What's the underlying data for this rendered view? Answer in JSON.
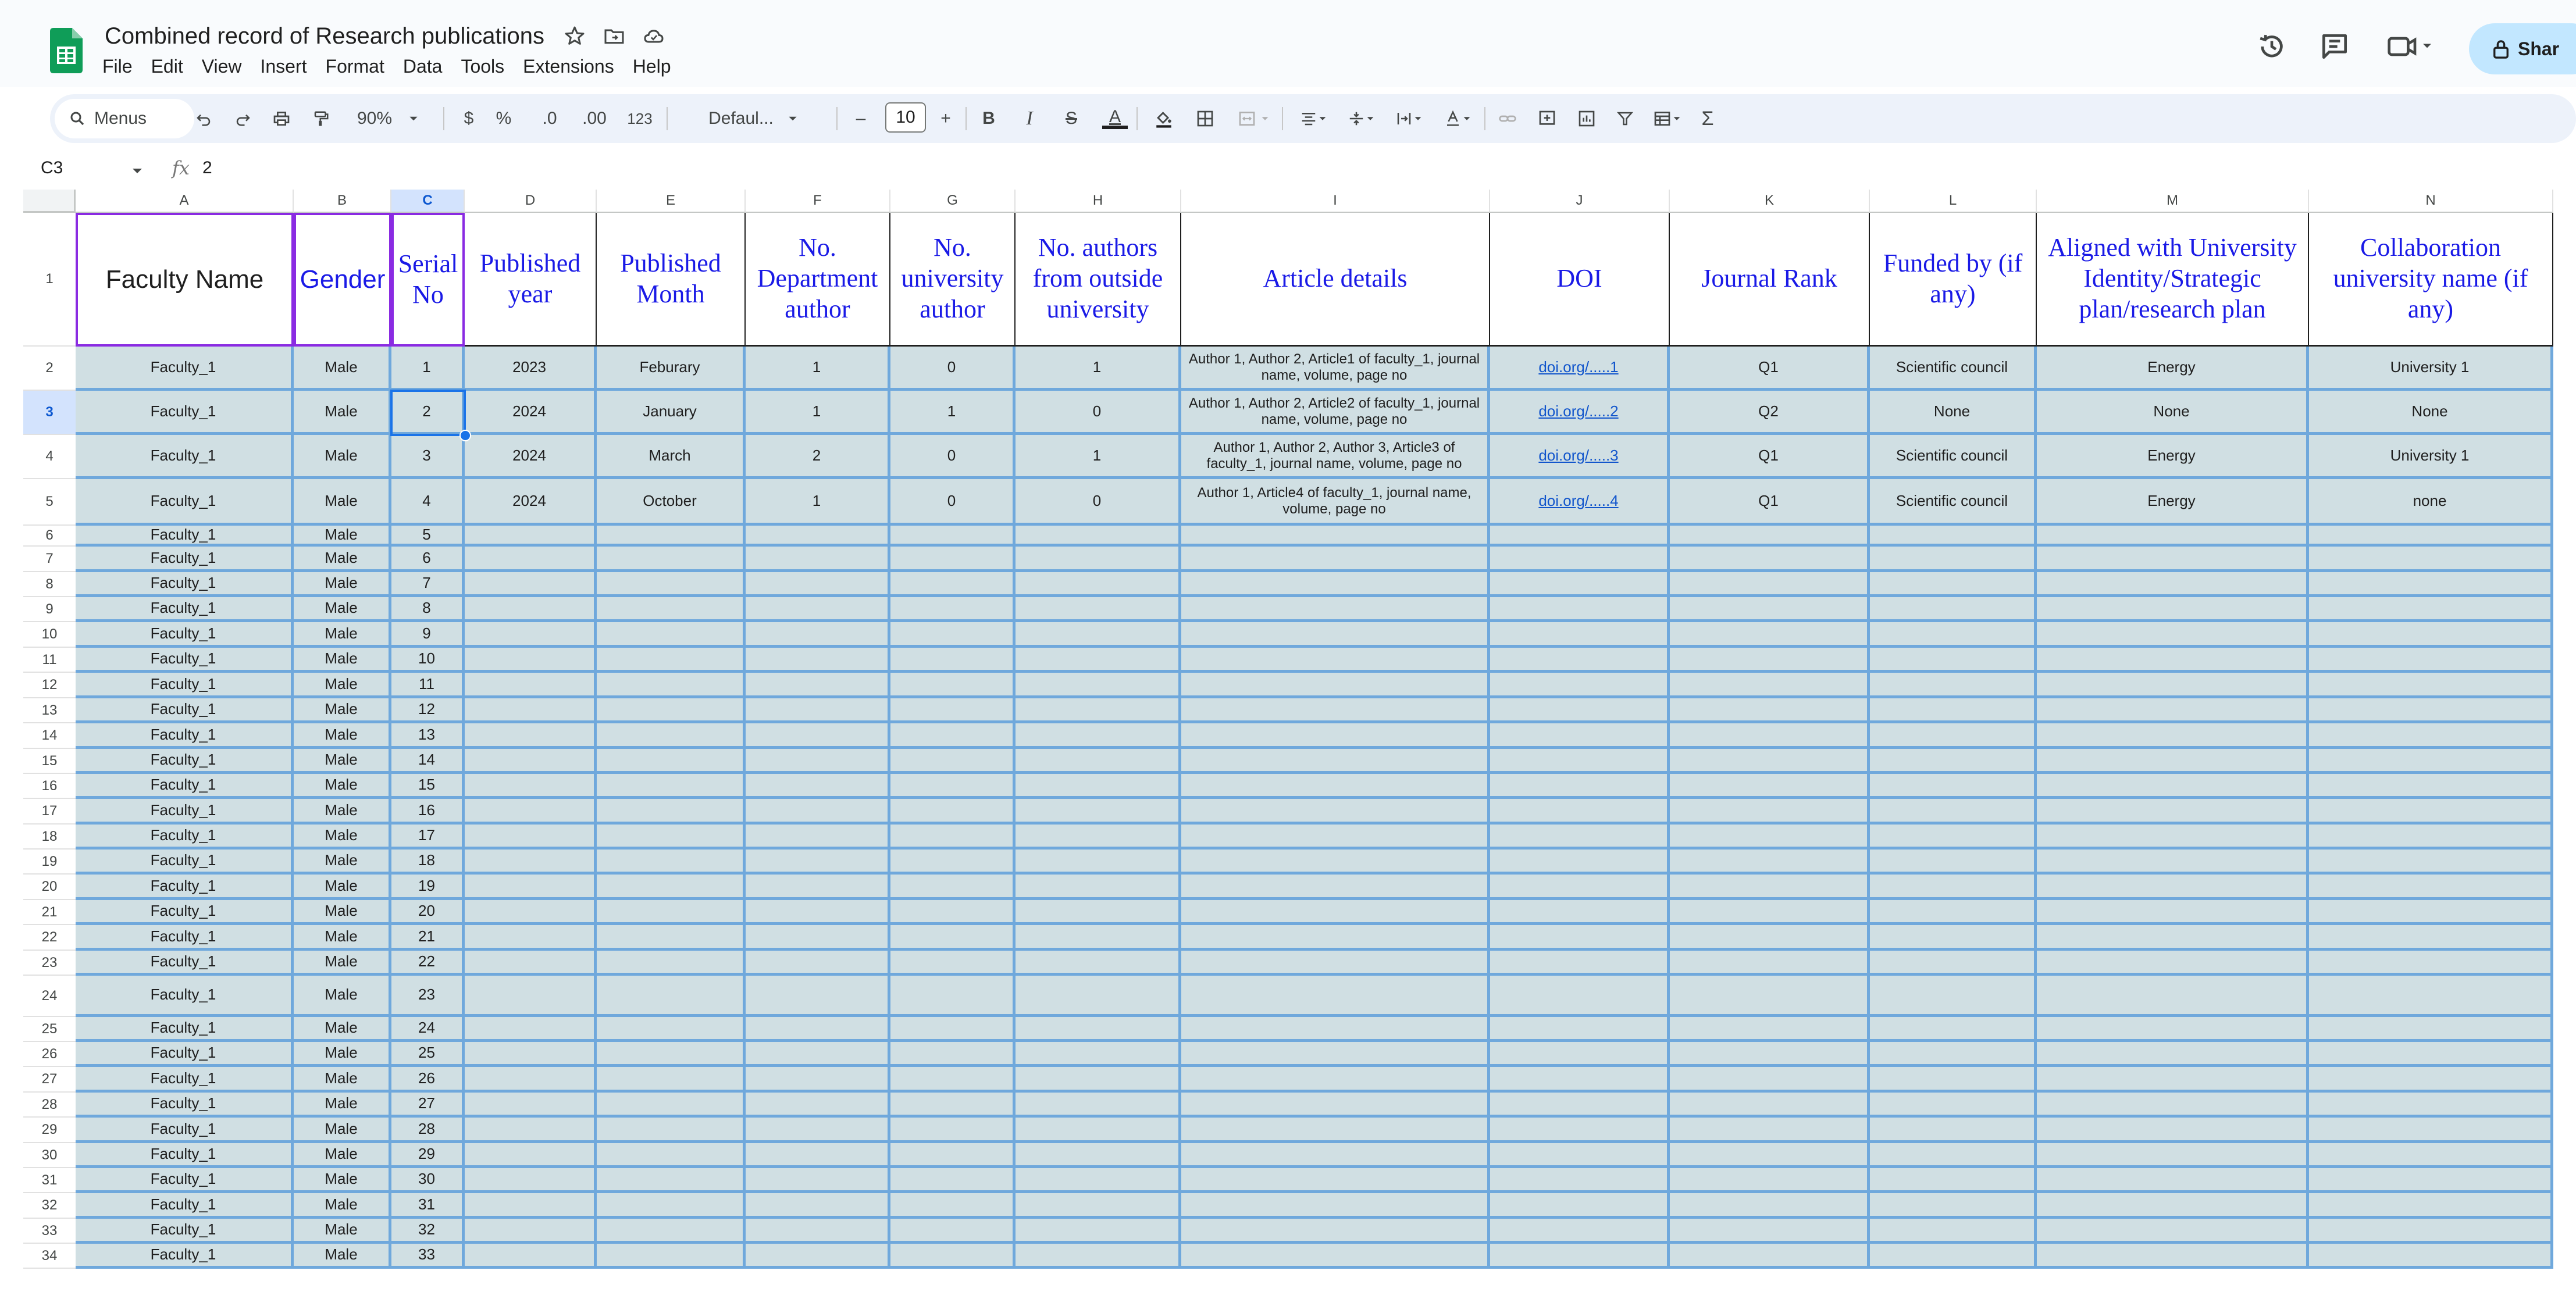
{
  "app": {
    "doc_title": "Combined record of Research publications",
    "menus": [
      "File",
      "Edit",
      "View",
      "Insert",
      "Format",
      "Data",
      "Tools",
      "Extensions",
      "Help"
    ],
    "share_label": "Shar"
  },
  "toolbar": {
    "search_label": "Menus",
    "zoom": "90%",
    "currency": "$",
    "percent": "%",
    "dec_decrease": ".0",
    "dec_increase": ".00",
    "number_format": "123",
    "font": "Defaul...",
    "font_size": "10",
    "minus": "–",
    "plus": "+",
    "bold": "B",
    "italic": "I",
    "strike": "S",
    "text_color": "A",
    "sigma": "Σ"
  },
  "formula_bar": {
    "cell_ref": "C3",
    "fx": "fx",
    "value": "2"
  },
  "grid": {
    "columns": [
      "A",
      "B",
      "C",
      "D",
      "E",
      "F",
      "G",
      "H",
      "I",
      "J",
      "K",
      "L",
      "M",
      "N"
    ],
    "active_column": "C",
    "active_row": 3,
    "headers": [
      "Faculty Name",
      "Gender",
      "Serial No",
      "Published year",
      "Published Month",
      "No. Department author",
      "No. university author",
      "No. authors from outside university",
      "Article details",
      "DOI",
      "Journal Rank",
      "Funded by (if any)",
      "Aligned with University Identity/Strategic plan/research plan",
      "Collaboration university name (if any)"
    ],
    "rows": [
      [
        "Faculty_1",
        "Male",
        "1",
        "2023",
        "Feburary",
        "1",
        "0",
        "1",
        "Author 1, Author 2, Article1 of faculty_1, journal name, volume, page no",
        "doi.org/.....1",
        "Q1",
        "Scientific council",
        "Energy",
        "University  1"
      ],
      [
        "Faculty_1",
        "Male",
        "2",
        "2024",
        "January",
        "1",
        "1",
        "0",
        "Author 1, Author 2, Article2 of faculty_1, journal name, volume, page no",
        "doi.org/.....2",
        "Q2",
        "None",
        "None",
        "None"
      ],
      [
        "Faculty_1",
        "Male",
        "3",
        "2024",
        "March",
        "2",
        "0",
        "1",
        "Author 1, Author 2, Author 3, Article3 of faculty_1, journal name, volume, page no",
        "doi.org/.....3",
        "Q1",
        "Scientific council",
        "Energy",
        "University  1"
      ],
      [
        "Faculty_1",
        "Male",
        "4",
        "2024",
        "October",
        "1",
        "0",
        "0",
        "Author 1, Article4 of faculty_1, journal name, volume, page no",
        "doi.org/.....4",
        "Q1",
        "Scientific council",
        "Energy",
        "none"
      ],
      [
        "Faculty_1",
        "Male",
        "5",
        "",
        "",
        "",
        "",
        "",
        "",
        "",
        "",
        "",
        "",
        ""
      ],
      [
        "Faculty_1",
        "Male",
        "6",
        "",
        "",
        "",
        "",
        "",
        "",
        "",
        "",
        "",
        "",
        ""
      ],
      [
        "Faculty_1",
        "Male",
        "7",
        "",
        "",
        "",
        "",
        "",
        "",
        "",
        "",
        "",
        "",
        ""
      ],
      [
        "Faculty_1",
        "Male",
        "8",
        "",
        "",
        "",
        "",
        "",
        "",
        "",
        "",
        "",
        "",
        ""
      ],
      [
        "Faculty_1",
        "Male",
        "9",
        "",
        "",
        "",
        "",
        "",
        "",
        "",
        "",
        "",
        "",
        ""
      ],
      [
        "Faculty_1",
        "Male",
        "10",
        "",
        "",
        "",
        "",
        "",
        "",
        "",
        "",
        "",
        "",
        ""
      ],
      [
        "Faculty_1",
        "Male",
        "11",
        "",
        "",
        "",
        "",
        "",
        "",
        "",
        "",
        "",
        "",
        ""
      ],
      [
        "Faculty_1",
        "Male",
        "12",
        "",
        "",
        "",
        "",
        "",
        "",
        "",
        "",
        "",
        "",
        ""
      ],
      [
        "Faculty_1",
        "Male",
        "13",
        "",
        "",
        "",
        "",
        "",
        "",
        "",
        "",
        "",
        "",
        ""
      ],
      [
        "Faculty_1",
        "Male",
        "14",
        "",
        "",
        "",
        "",
        "",
        "",
        "",
        "",
        "",
        "",
        ""
      ],
      [
        "Faculty_1",
        "Male",
        "15",
        "",
        "",
        "",
        "",
        "",
        "",
        "",
        "",
        "",
        "",
        ""
      ],
      [
        "Faculty_1",
        "Male",
        "16",
        "",
        "",
        "",
        "",
        "",
        "",
        "",
        "",
        "",
        "",
        ""
      ],
      [
        "Faculty_1",
        "Male",
        "17",
        "",
        "",
        "",
        "",
        "",
        "",
        "",
        "",
        "",
        "",
        ""
      ],
      [
        "Faculty_1",
        "Male",
        "18",
        "",
        "",
        "",
        "",
        "",
        "",
        "",
        "",
        "",
        "",
        ""
      ],
      [
        "Faculty_1",
        "Male",
        "19",
        "",
        "",
        "",
        "",
        "",
        "",
        "",
        "",
        "",
        "",
        ""
      ],
      [
        "Faculty_1",
        "Male",
        "20",
        "",
        "",
        "",
        "",
        "",
        "",
        "",
        "",
        "",
        "",
        ""
      ],
      [
        "Faculty_1",
        "Male",
        "21",
        "",
        "",
        "",
        "",
        "",
        "",
        "",
        "",
        "",
        "",
        ""
      ],
      [
        "Faculty_1",
        "Male",
        "22",
        "",
        "",
        "",
        "",
        "",
        "",
        "",
        "",
        "",
        "",
        ""
      ],
      [
        "Faculty_1",
        "Male",
        "23",
        "",
        "",
        "",
        "",
        "",
        "",
        "",
        "",
        "",
        "",
        ""
      ],
      [
        "Faculty_1",
        "Male",
        "24",
        "",
        "",
        "",
        "",
        "",
        "",
        "",
        "",
        "",
        "",
        ""
      ],
      [
        "Faculty_1",
        "Male",
        "25",
        "",
        "",
        "",
        "",
        "",
        "",
        "",
        "",
        "",
        "",
        ""
      ],
      [
        "Faculty_1",
        "Male",
        "26",
        "",
        "",
        "",
        "",
        "",
        "",
        "",
        "",
        "",
        "",
        ""
      ],
      [
        "Faculty_1",
        "Male",
        "27",
        "",
        "",
        "",
        "",
        "",
        "",
        "",
        "",
        "",
        "",
        ""
      ],
      [
        "Faculty_1",
        "Male",
        "28",
        "",
        "",
        "",
        "",
        "",
        "",
        "",
        "",
        "",
        "",
        ""
      ],
      [
        "Faculty_1",
        "Male",
        "29",
        "",
        "",
        "",
        "",
        "",
        "",
        "",
        "",
        "",
        "",
        ""
      ],
      [
        "Faculty_1",
        "Male",
        "30",
        "",
        "",
        "",
        "",
        "",
        "",
        "",
        "",
        "",
        "",
        ""
      ],
      [
        "Faculty_1",
        "Male",
        "31",
        "",
        "",
        "",
        "",
        "",
        "",
        "",
        "",
        "",
        "",
        ""
      ],
      [
        "Faculty_1",
        "Male",
        "32",
        "",
        "",
        "",
        "",
        "",
        "",
        "",
        "",
        "",
        "",
        ""
      ],
      [
        "Faculty_1",
        "Male",
        "33",
        "",
        "",
        "",
        "",
        "",
        "",
        "",
        "",
        "",
        "",
        ""
      ]
    ]
  },
  "colors": {
    "header_text": "#1a1ae6",
    "data_fill": "#d0dfe3",
    "data_border": "#6fa8dc",
    "header_highlight": "#8a2be2",
    "selection": "#1a73e8",
    "link": "#1155cc"
  },
  "icons": {
    "sheets_logo": "sheets-logo-icon",
    "star": "star-icon",
    "move": "move-to-folder-icon",
    "cloud": "cloud-status-icon",
    "history": "history-icon",
    "comments": "comments-icon",
    "meet": "video-call-icon",
    "lock": "lock-icon"
  }
}
